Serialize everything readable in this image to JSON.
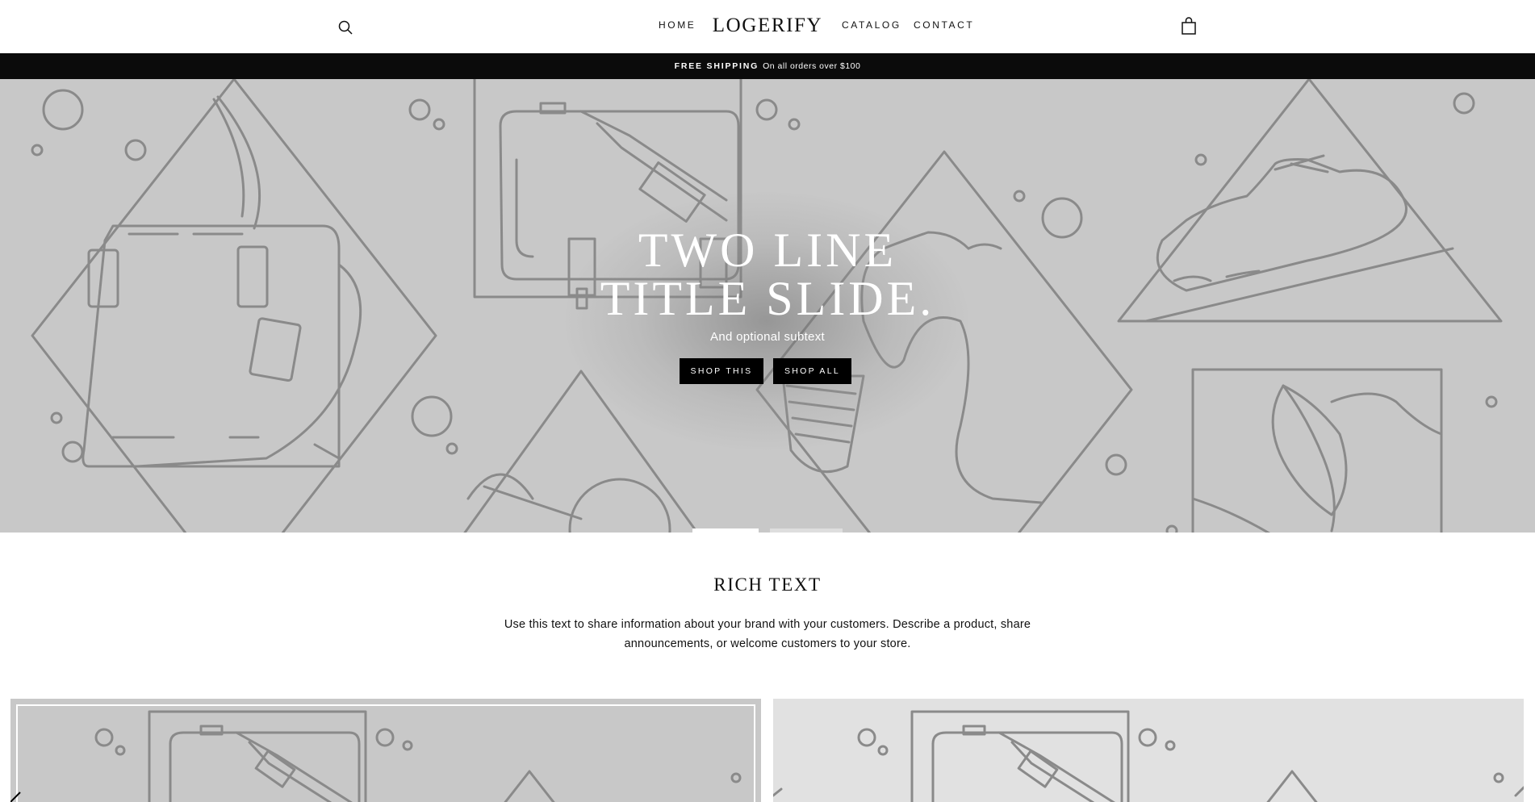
{
  "header": {
    "search_icon": "search-icon",
    "nav_left": [
      {
        "label": "HOME"
      }
    ],
    "logo": "LOGERIFY",
    "nav_right": [
      {
        "label": "CATALOG"
      },
      {
        "label": "CONTACT"
      }
    ],
    "cart_icon": "cart-icon"
  },
  "announcement": {
    "bold": "FREE SHIPPING",
    "text": "On all orders over $100"
  },
  "hero": {
    "title_line1": "TWO LINE",
    "title_line2": "TITLE SLIDE.",
    "subtext": "And optional subtext",
    "buttons": [
      {
        "label": "SHOP THIS"
      },
      {
        "label": "SHOP ALL"
      }
    ],
    "slides": [
      {
        "active": true
      },
      {
        "active": false
      }
    ]
  },
  "rich_text": {
    "heading": "RICH TEXT",
    "body_line1": "Use this text to share information about your brand with your customers. Describe a product, share",
    "body_line2": "announcements, or welcome customers to your store."
  },
  "colors": {
    "hero_bg": "#c8c8c8",
    "line_art": "#8a8a8a",
    "announcement_bg": "#0b0b0b",
    "button_bg": "#000000",
    "tile_left_bg": "#c8c8c8",
    "tile_right_bg": "#e1e1e1"
  }
}
